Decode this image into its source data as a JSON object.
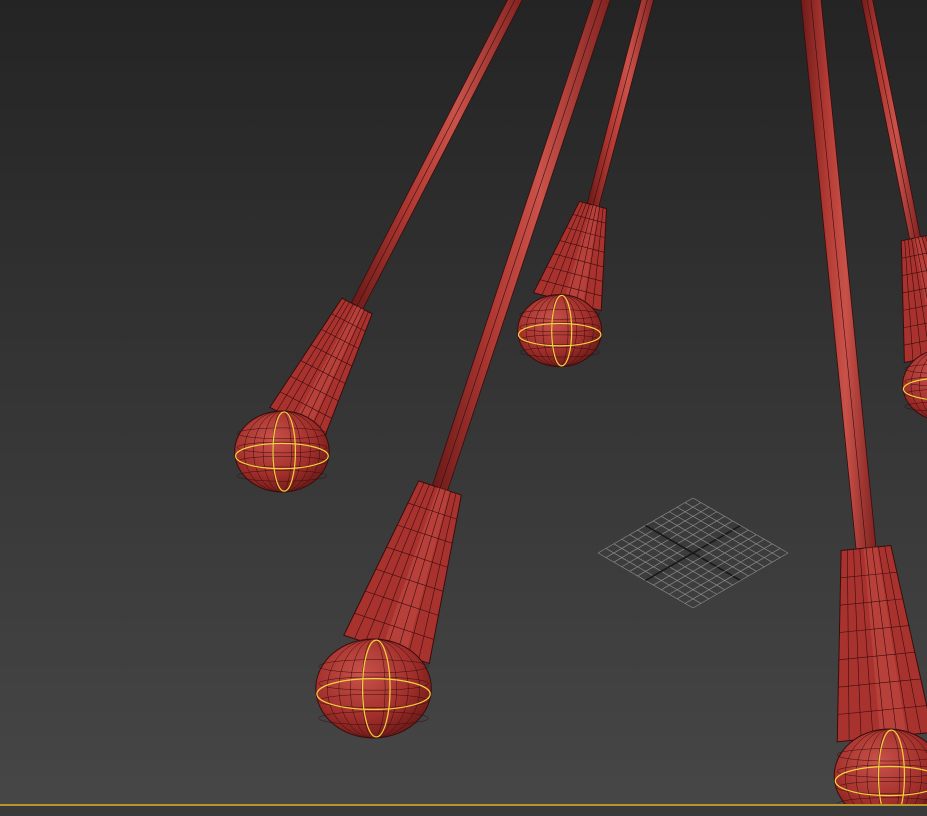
{
  "viewport": {
    "background_top": "#242424",
    "background_bottom": "#474747",
    "active_border_color": "#b8962e"
  },
  "scene": {
    "object_color": "#a8322e",
    "object_highlight": "#c9524a",
    "object_shadow": "#6a1a18",
    "wire_color": "#3a0c0c",
    "selected_edge_color": "#f2d23c",
    "grid_color": "#8a8a8a",
    "grid_axis_color": "#1a1a1a",
    "grid_icon": "home-grid-icon"
  }
}
